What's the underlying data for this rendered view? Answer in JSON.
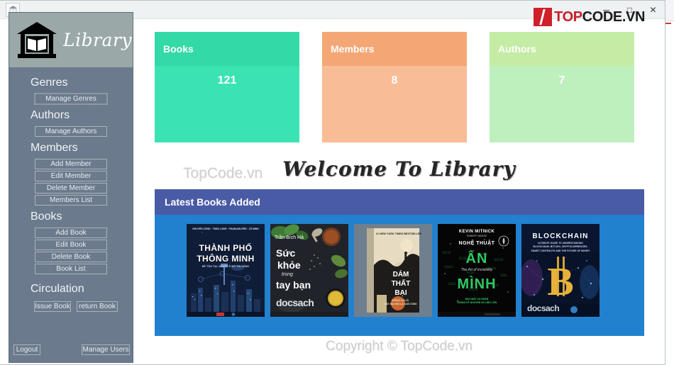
{
  "window": {
    "titlebar_icon": "library-app-icon",
    "controls": {
      "minimize": "─",
      "maximize": "□",
      "close": "✕"
    }
  },
  "branding": {
    "logo_badge": "{/}",
    "logo_text_primary": "TOP",
    "logo_text_secondary": "CODE.VN"
  },
  "sidebar": {
    "logo_icon": "library-building-icon",
    "logo_title": "Library",
    "sections": [
      {
        "heading": "Genres",
        "buttons": [
          {
            "label": "Manage Genres",
            "focused": true
          }
        ]
      },
      {
        "heading": "Authors",
        "buttons": [
          {
            "label": "Manage Authors",
            "focused": false
          }
        ]
      },
      {
        "heading": "Members",
        "buttons": [
          {
            "label": "Add Member",
            "focused": false
          },
          {
            "label": "Edit Member",
            "focused": false
          },
          {
            "label": "Delete Member",
            "focused": false
          },
          {
            "label": "Members List",
            "focused": false
          }
        ]
      },
      {
        "heading": "Books",
        "buttons": [
          {
            "label": "Add Book",
            "focused": false
          },
          {
            "label": "Edit Book",
            "focused": false
          },
          {
            "label": "Delete Book",
            "focused": false
          },
          {
            "label": "Book List",
            "focused": false
          }
        ]
      },
      {
        "heading": "Circulation",
        "buttons": [
          {
            "label": "Issue Book",
            "focused": false
          },
          {
            "label": "return Book",
            "focused": false
          }
        ]
      }
    ],
    "footer": {
      "logout_label": "Logout",
      "manage_users_label": "Manage Users"
    }
  },
  "stats": {
    "cards": [
      {
        "title": "Books",
        "value": "121",
        "header_color": "#33d9a6",
        "body_color": "#3ce3b2"
      },
      {
        "title": "Members",
        "value": "8",
        "header_color": "#f4a775",
        "body_color": "#f8bc96"
      },
      {
        "title": "Authors",
        "value": "7",
        "header_color": "#c4eca4",
        "body_color": "#bdf0bd"
      }
    ]
  },
  "hero": {
    "watermark": "TopCode.vn",
    "welcome_text": "Welcome To Library"
  },
  "latest_books": {
    "panel_title": "Latest Books Added",
    "panel_header_color": "#4a5ba5",
    "panel_body_color": "#2281ce",
    "covers": [
      {
        "id": "cover-thanh-pho-thong-minh",
        "title_line1": "THÀNH PHỐ",
        "title_line2": "THÔNG MINH",
        "subtitle": "ĐỄ TỒN TẠI, NGƯỜI Ở ĐÔ THỊ SỐNG",
        "authors": "NGUYỄN CÔNG · TRẦN LONG · PHẠM NGUYÊN · LÊ MINH",
        "bg": "#101d38",
        "accent": "#ffffff"
      },
      {
        "id": "cover-suc-khoe-trong-tay-ban",
        "author": "Trần Bích Hà",
        "title_line1": "Sức",
        "title_line2": "khỏe",
        "title_line3": "trong",
        "title_line4": "tay bạn",
        "publisher": "docsach",
        "bg": "#20242a",
        "accent": "#ffffff"
      },
      {
        "id": "cover-dam-that-bai",
        "banner": "#1 NEW YORK TIMES BESTSELLER",
        "title_line1": "DÁM",
        "title_line2": "THẤT",
        "title_line3": "BẠI",
        "subtitle": "KHÔNG CÓ LỖI\nTHẤT BẠI NÀO LÀ CUỐI CÙNG",
        "bg": "#cfc5ae",
        "accent": "#1b1b1b"
      },
      {
        "id": "cover-nghe-thuat-an-minh",
        "author": "KEVIN MITNICK",
        "author_sub": "ROBERT VAMOSI",
        "title_line1": "NGHỆ THUẬT",
        "title_line2": "ẨN",
        "title_line3": "MÌNH",
        "subtitle": "The Art of Invisibility",
        "footer": "BÁO MẬT CÁ NHÂN\nTRONG KỶ NGUYÊN SỐ LIỆU LỚN",
        "bg": "#050505",
        "accent": "#35d96b"
      },
      {
        "id": "cover-blockchain",
        "title_line1": "BLOCKCHAIN",
        "subtitle": "ULTIMATE GUIDE TO UNDERSTANDING\nBLOCKCHAIN, BITCOIN, CRYPTOCURRENCIES,\nSMART CONTRACTS AND THE FUTURE OF MONEY",
        "publisher": "docsach",
        "symbol": "₿",
        "bg": "#0a1530",
        "accent": "#e8b23a"
      }
    ]
  },
  "footer": {
    "copyright": "Copyright © TopCode.vn"
  }
}
